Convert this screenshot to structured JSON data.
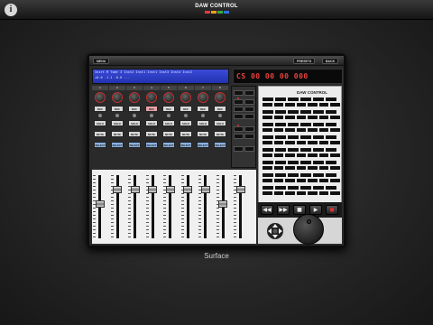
{
  "app": {
    "title": "DAW CONTROL",
    "info_icon": "info-icon",
    "brand_colors": [
      "#e23c3c",
      "#f0a020",
      "#30b040",
      "#3070e0"
    ]
  },
  "menu": {
    "menu_label": "MENU",
    "presets_label": "PRESETS",
    "back_label": "BACK"
  },
  "lcd": {
    "line1": "Insrt M Tomt 3 Inst2 Inst1 Inst1 Inst3 Inst4 Inst2",
    "line2": "+0.0  -1.1  -0.6 ..."
  },
  "timecode": {
    "display": "CS   00 00 00 000"
  },
  "channels": [
    {
      "number": "1",
      "rec_label": "REC",
      "solo_label": "SOLO",
      "mute_label": "MUTE",
      "select_label": "SELECT",
      "rec_active": false,
      "fader_level": 0.55
    },
    {
      "number": "2",
      "rec_label": "REC",
      "solo_label": "SOLO",
      "mute_label": "MUTE",
      "select_label": "SELECT",
      "rec_active": false,
      "fader_level": 0.8
    },
    {
      "number": "3",
      "rec_label": "REC",
      "solo_label": "SOLO",
      "mute_label": "MUTE",
      "select_label": "SELECT",
      "rec_active": false,
      "fader_level": 0.8
    },
    {
      "number": "4",
      "rec_label": "REC",
      "solo_label": "SOLO",
      "mute_label": "MUTE",
      "select_label": "SELECT",
      "rec_active": true,
      "fader_level": 0.8
    },
    {
      "number": "5",
      "rec_label": "REC",
      "solo_label": "SOLO",
      "mute_label": "MUTE",
      "select_label": "SELECT",
      "rec_active": false,
      "fader_level": 0.8
    },
    {
      "number": "6",
      "rec_label": "REC",
      "solo_label": "SOLO",
      "mute_label": "MUTE",
      "select_label": "SELECT",
      "rec_active": false,
      "fader_level": 0.8
    },
    {
      "number": "7",
      "rec_label": "REC",
      "solo_label": "SOLO",
      "mute_label": "MUTE",
      "select_label": "SELECT",
      "rec_active": false,
      "fader_level": 0.8
    },
    {
      "number": "8",
      "rec_label": "REC",
      "solo_label": "SOLO",
      "mute_label": "MUTE",
      "select_label": "SELECT",
      "rec_active": false,
      "fader_level": 0.55
    }
  ],
  "master": {
    "fader_level": 0.8
  },
  "panel": {
    "title": "DAW CONTROL"
  },
  "transport": {
    "rewind": "◀◀",
    "forward": "▶▶",
    "stop": "■",
    "play": "▶",
    "record": "●"
  },
  "caption": "Surface"
}
